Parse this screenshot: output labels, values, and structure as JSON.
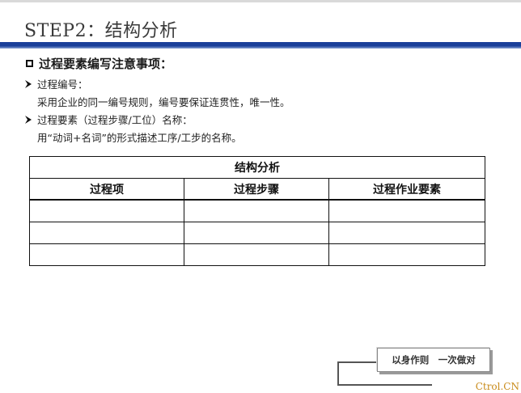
{
  "title": "STEP2：结构分析",
  "heading": "过程要素编写注意事项：",
  "bullets": [
    {
      "label": "过程编号：",
      "detail": "采用企业的同一编号规则，编号要保证连贯性，唯一性。"
    },
    {
      "label": "过程要素（过程步骤/工位）名称：",
      "detail": "用“动词+名词”的形式描述工序/工步的名称。"
    }
  ],
  "table": {
    "caption": "结构分析",
    "headers": [
      "过程项",
      "过程步骤",
      "过程作业要素"
    ],
    "rows": [
      [
        "",
        "",
        ""
      ],
      [
        "",
        "",
        ""
      ],
      [
        "",
        "",
        ""
      ]
    ]
  },
  "motto": "以身作则　一次做对",
  "brand": "Ctrol.CN",
  "colors": {
    "accent_bar": "#1a3f9a",
    "brand": "#c98b1a"
  }
}
